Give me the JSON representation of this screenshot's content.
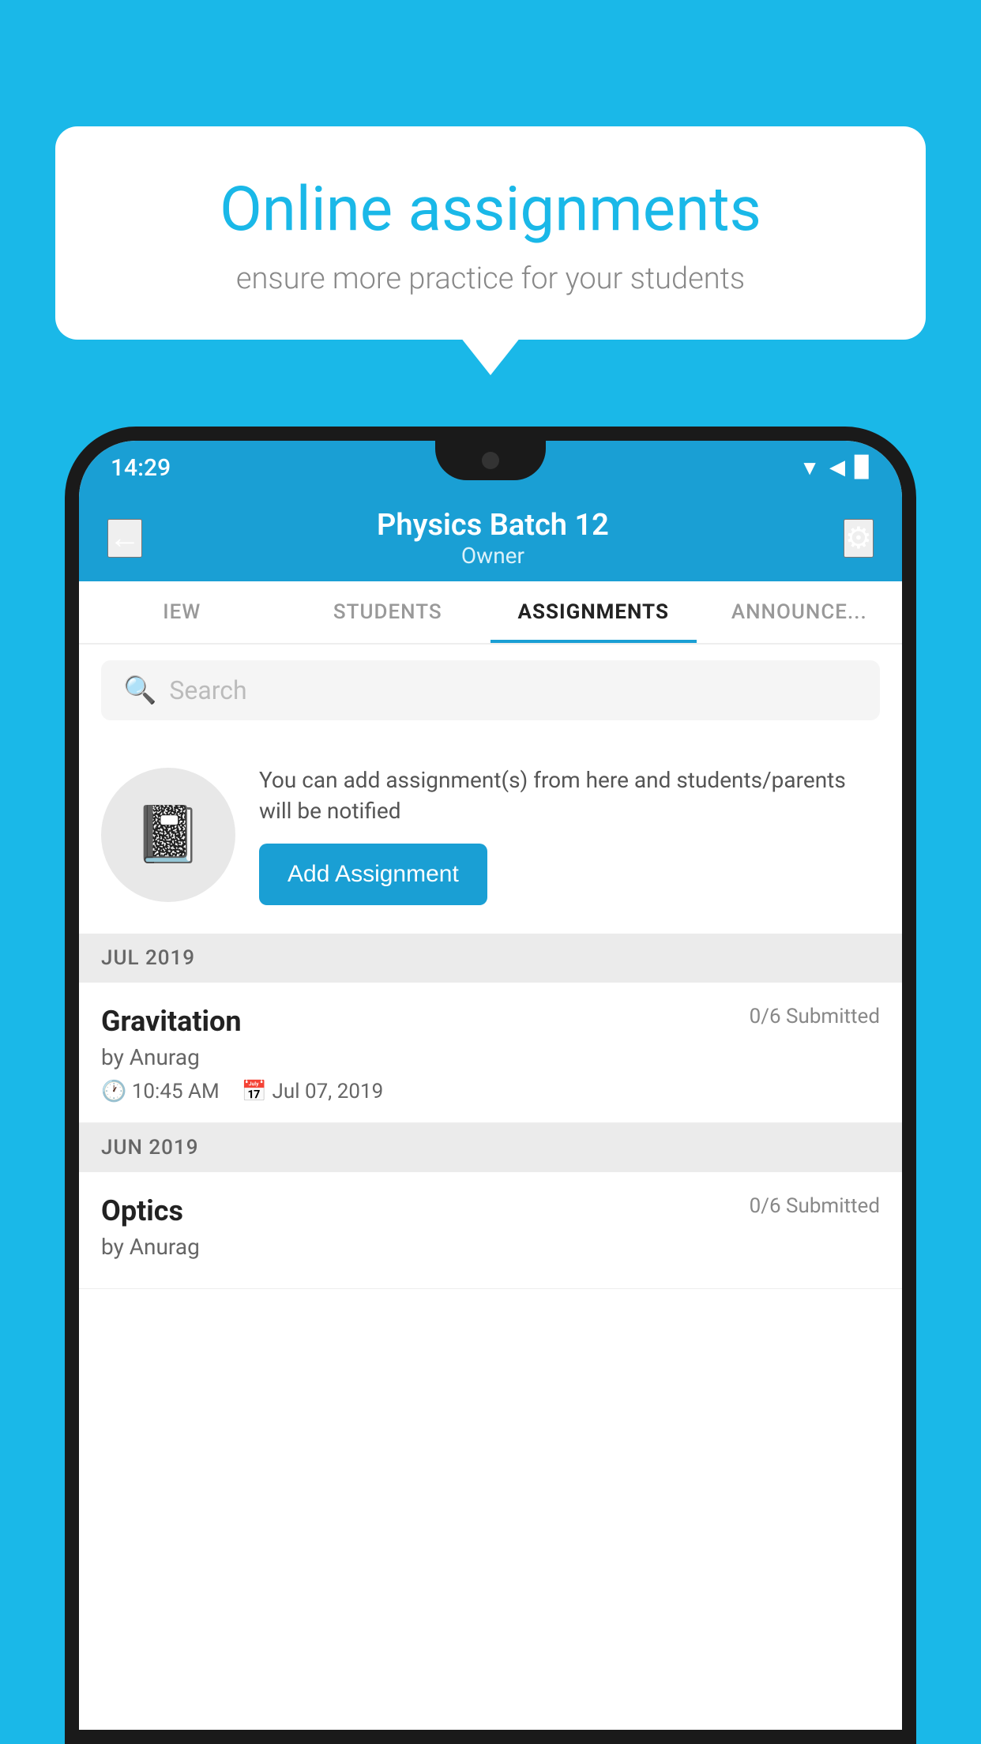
{
  "background": {
    "color": "#1ab8e8"
  },
  "speech_bubble": {
    "title": "Online assignments",
    "subtitle": "ensure more practice for your students"
  },
  "status_bar": {
    "time": "14:29",
    "wifi": "▲",
    "signal": "▲",
    "battery": "▉"
  },
  "app_bar": {
    "back_label": "←",
    "title": "Physics Batch 12",
    "subtitle": "Owner",
    "settings_label": "⚙"
  },
  "tabs": [
    {
      "label": "IEW",
      "active": false
    },
    {
      "label": "STUDENTS",
      "active": false
    },
    {
      "label": "ASSIGNMENTS",
      "active": true
    },
    {
      "label": "ANNOUNCEMENTS",
      "active": false
    }
  ],
  "search": {
    "placeholder": "Search"
  },
  "promo": {
    "description": "You can add assignment(s) from here and students/parents will be notified",
    "button_label": "Add Assignment"
  },
  "sections": [
    {
      "month": "JUL 2019",
      "assignments": [
        {
          "title": "Gravitation",
          "submitted": "0/6 Submitted",
          "by": "by Anurag",
          "time": "10:45 AM",
          "date": "Jul 07, 2019"
        }
      ]
    },
    {
      "month": "JUN 2019",
      "assignments": [
        {
          "title": "Optics",
          "submitted": "0/6 Submitted",
          "by": "by Anurag",
          "time": "",
          "date": ""
        }
      ]
    }
  ]
}
